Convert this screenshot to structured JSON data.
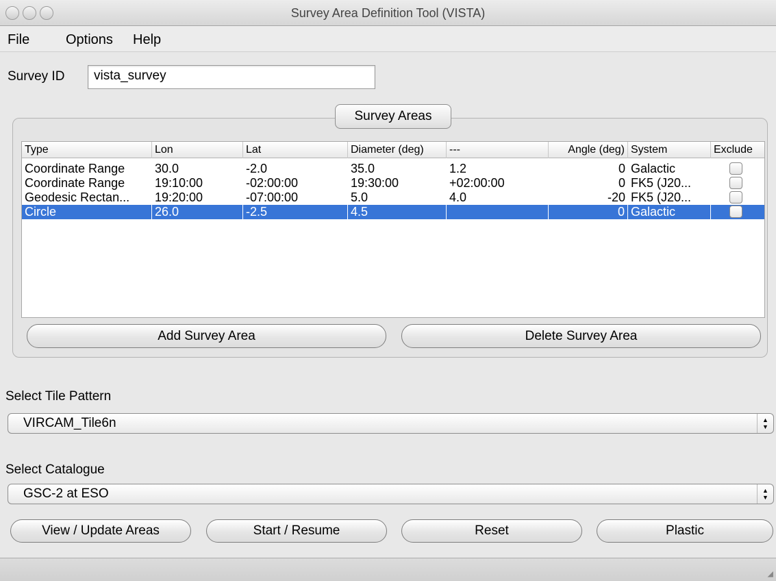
{
  "window": {
    "title": "Survey Area Definition Tool (VISTA)"
  },
  "menu": [
    "File",
    "Options",
    "Help"
  ],
  "survey_id": {
    "label": "Survey ID",
    "value": "vista_survey"
  },
  "survey_areas": {
    "title": "Survey Areas",
    "columns": [
      "Type",
      "Lon",
      "Lat",
      "Diameter (deg)",
      "---",
      "Angle (deg)",
      "System",
      "Exclude"
    ],
    "rows": [
      {
        "type": "Coordinate Range",
        "lon": "30.0",
        "lat": "-2.0",
        "diameter": "35.0",
        "extra": "1.2",
        "angle": "0",
        "system": "Galactic",
        "exclude": false,
        "selected": false
      },
      {
        "type": "Coordinate Range",
        "lon": "19:10:00",
        "lat": "-02:00:00",
        "diameter": "19:30:00",
        "extra": "+02:00:00",
        "angle": "0",
        "system": "FK5 (J20...",
        "exclude": false,
        "selected": false
      },
      {
        "type": "Geodesic Rectan...",
        "lon": "19:20:00",
        "lat": "-07:00:00",
        "diameter": "5.0",
        "extra": "4.0",
        "angle": "-20",
        "system": "FK5 (J20...",
        "exclude": false,
        "selected": false
      },
      {
        "type": "Circle",
        "lon": "26.0",
        "lat": "-2.5",
        "diameter": "4.5",
        "extra": "",
        "angle": "0",
        "system": "Galactic",
        "exclude": false,
        "selected": true
      }
    ],
    "add_label": "Add Survey Area",
    "delete_label": "Delete Survey Area"
  },
  "tile_pattern": {
    "label": "Select Tile Pattern",
    "value": "VIRCAM_Tile6n"
  },
  "catalogue": {
    "label": "Select Catalogue",
    "value": "GSC-2 at ESO"
  },
  "actions": {
    "view_update": "View / Update Areas",
    "start_resume": "Start / Resume",
    "reset": "Reset",
    "plastic": "Plastic"
  },
  "colors": {
    "selection": "#3875d7",
    "background": "#e8e8e8"
  }
}
